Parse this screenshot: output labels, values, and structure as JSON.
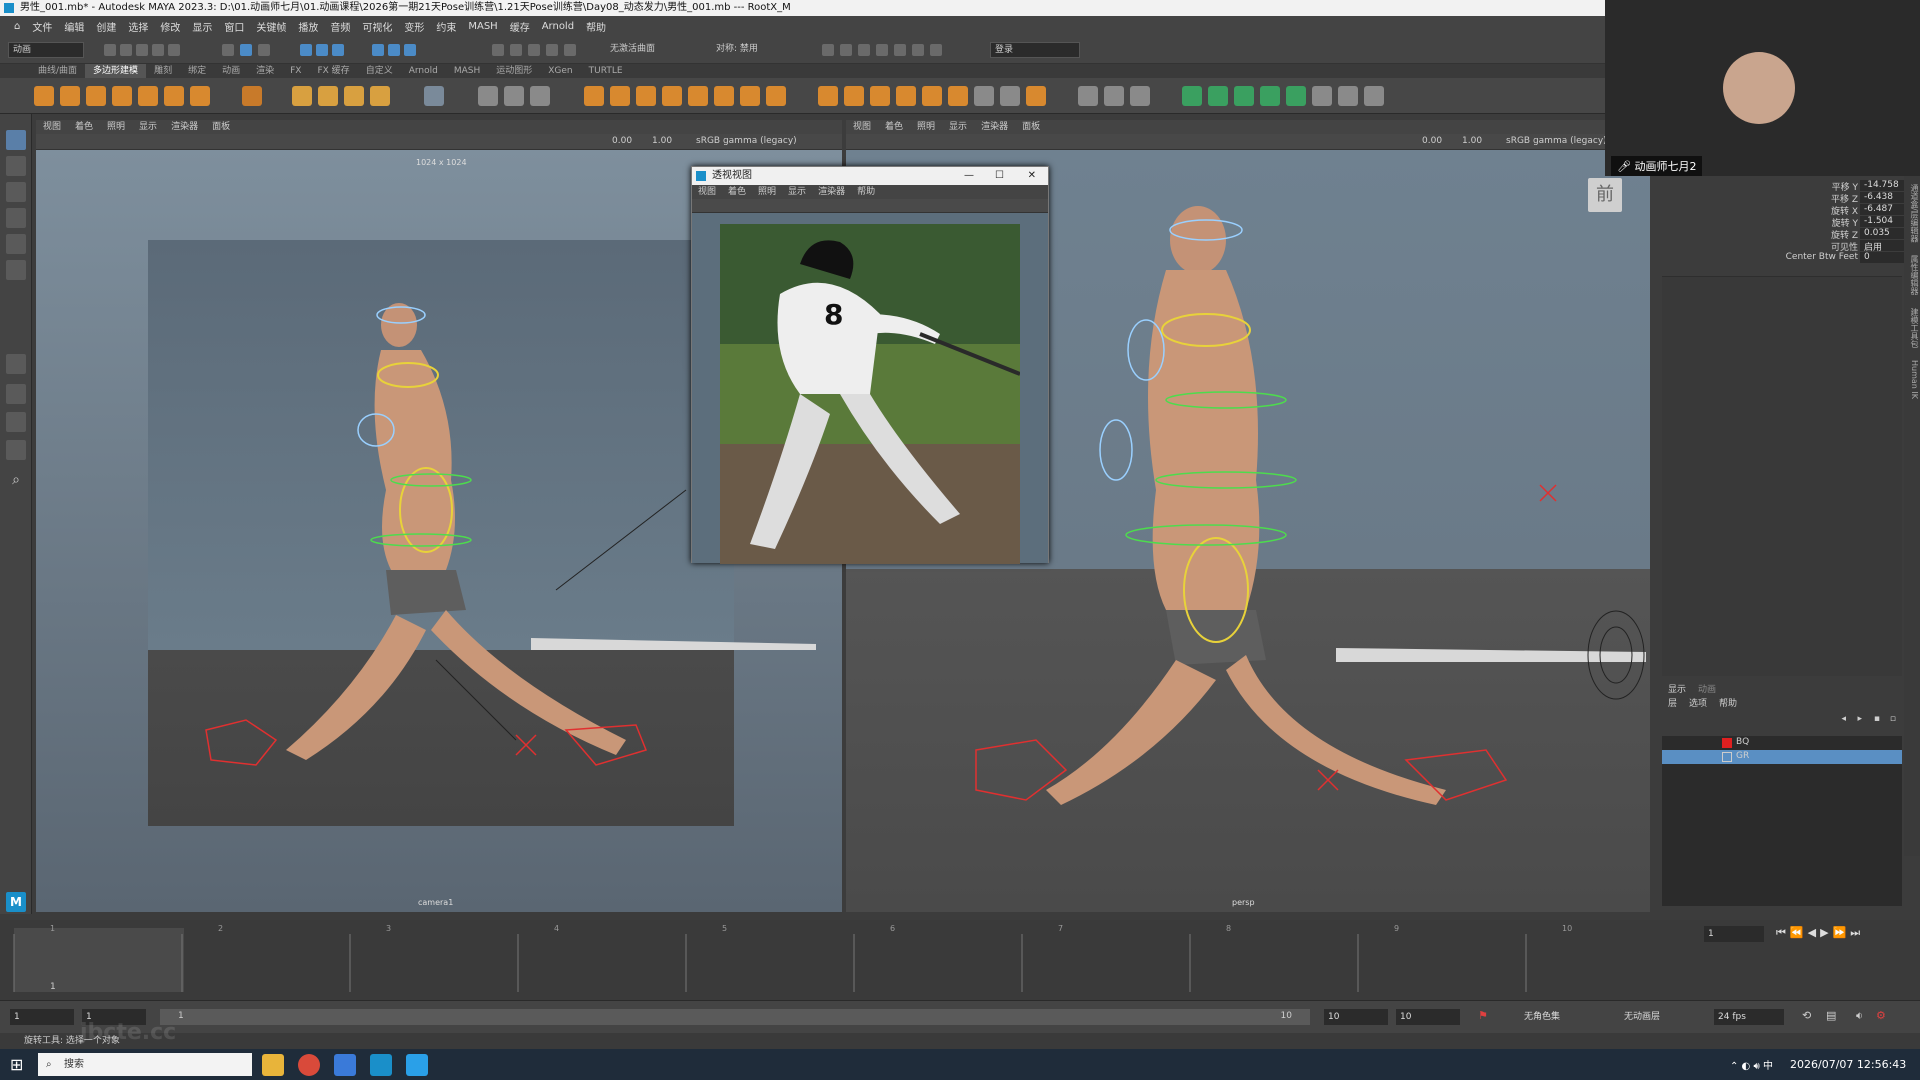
{
  "titlebar": {
    "title": "男性_001.mb* - Autodesk MAYA 2023.3: D:\\01.动画师七月\\01.动画课程\\2026第一期21天Pose训练营\\1.21天Pose训练营\\Day08_动态发力\\男性_001.mb   ---   RootX_M"
  },
  "menubar": {
    "items": [
      "文件",
      "编辑",
      "创建",
      "选择",
      "修改",
      "显示",
      "窗口",
      "关键帧",
      "播放",
      "音频",
      "可视化",
      "变形",
      "约束",
      "MASH",
      "缓存",
      "Arnold",
      "帮助"
    ]
  },
  "toolbar": {
    "mode_dropdown": "动画",
    "surface_label": "无激活曲面",
    "symmetry_label": "对称: 禁用",
    "login_label": "登录"
  },
  "shelf": {
    "tabs": [
      "曲线/曲面",
      "多边形建模",
      "雕刻",
      "绑定",
      "动画",
      "渲染",
      "FX",
      "FX 缓存",
      "自定义",
      "Arnold",
      "MASH",
      "运动图形",
      "XGen",
      "TURTLE"
    ],
    "active_tab": "多边形建模"
  },
  "left_panel": {
    "menu": [
      "视图",
      "着色",
      "照明",
      "显示",
      "渲染器",
      "面板"
    ],
    "exposure": "0.00",
    "gamma": "1.00",
    "colorspace": "sRGB gamma (legacy)",
    "resolution": "1024 x 1024",
    "camera": "camera1"
  },
  "right_panel": {
    "menu": [
      "视图",
      "着色",
      "照明",
      "显示",
      "渲染器",
      "面板"
    ],
    "exposure": "0.00",
    "gamma": "1.00",
    "colorspace": "sRGB gamma (legacy)",
    "camera": "persp",
    "viewcube_label": "前"
  },
  "float_window": {
    "title": "透视视图",
    "menu": [
      "视图",
      "着色",
      "照明",
      "显示",
      "渲染器",
      "帮助"
    ],
    "jersey_number": "8"
  },
  "webcam": {
    "name": "动画师七月2"
  },
  "channel_box": {
    "rows": [
      {
        "name": "平移 Y",
        "value": "-14.758"
      },
      {
        "name": "平移 Z",
        "value": "-6.438"
      },
      {
        "name": "旋转 X",
        "value": "-6.487"
      },
      {
        "name": "旋转 Y",
        "value": "-1.504"
      },
      {
        "name": "旋转 Z",
        "value": "0.035"
      },
      {
        "name": "可见性",
        "value": "启用"
      },
      {
        "name": "Center Btw Feet",
        "value": "0"
      }
    ],
    "side_tabs": [
      "通道盒/层编辑器",
      "属性编辑器",
      "建模工具包",
      "Human IK"
    ]
  },
  "layer_editor": {
    "tabs": [
      "显示",
      "动画"
    ],
    "menu": [
      "层",
      "选项",
      "帮助"
    ],
    "layers": [
      {
        "name": "BQ",
        "color": "#e02020"
      },
      {
        "name": "GR",
        "color": "#888888"
      }
    ]
  },
  "timeline": {
    "ticks": [
      "1",
      "2",
      "3",
      "4",
      "5",
      "6",
      "7",
      "8",
      "9",
      "10"
    ],
    "current_frame": "1",
    "current_frame_field": "1"
  },
  "range": {
    "start": "1",
    "inner_start": "1",
    "slider_start": "1",
    "slider_end": "10",
    "inner_end": "10",
    "end": "10",
    "character_set": "无角色集",
    "anim_layer": "无动画层",
    "fps": "24 fps"
  },
  "helpline": {
    "text": "旋转工具: 选择一个对象"
  },
  "taskbar": {
    "search_placeholder": "搜索",
    "datetime": "2026/07/07 12:56:43"
  },
  "watermark": "jbcte.cc"
}
